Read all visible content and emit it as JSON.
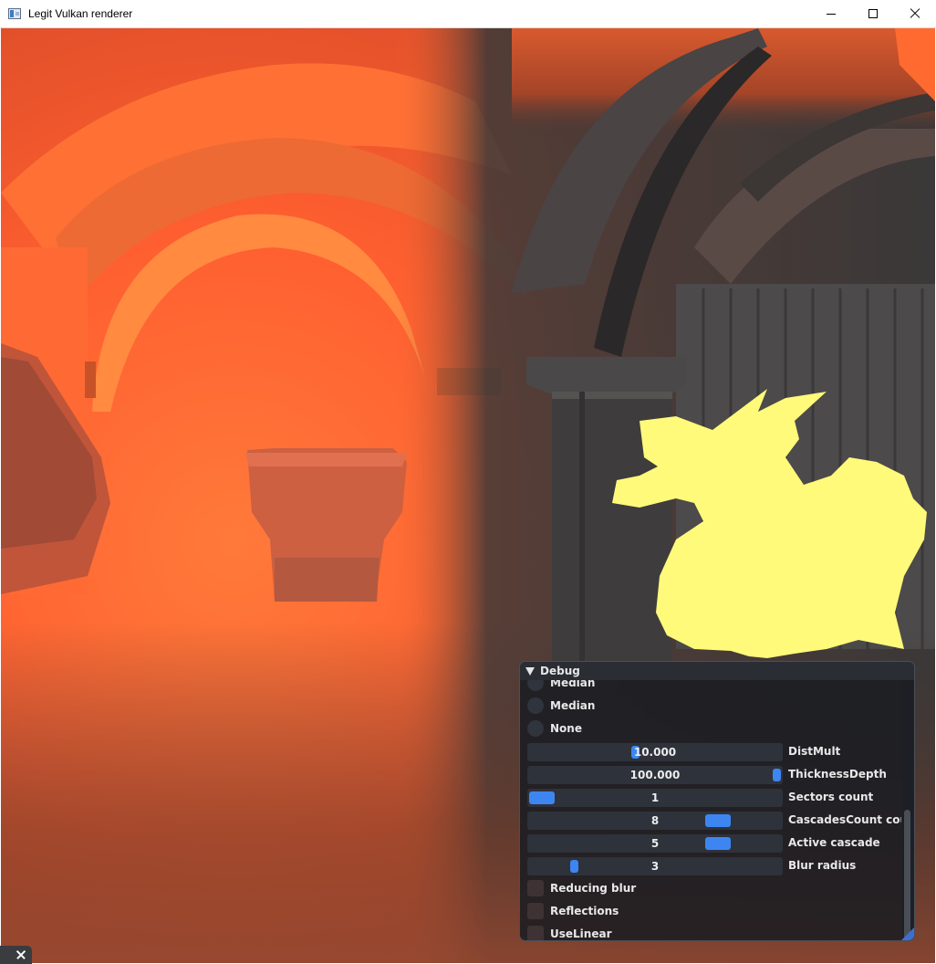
{
  "window": {
    "title": "Legit Vulkan renderer"
  },
  "debug_panel": {
    "title": "Debug",
    "radio_options": [
      {
        "label": "Median"
      },
      {
        "label": "Median"
      },
      {
        "label": "None"
      }
    ],
    "sliders": [
      {
        "name": "DistMult",
        "value": "10.000",
        "fraction": 0.42
      },
      {
        "name": "ThicknessDepth",
        "value": "100.000",
        "fraction": 1.0
      },
      {
        "name": "Sectors count",
        "value": "1",
        "fraction": 0.0
      },
      {
        "name": "CascadesCount coun",
        "value": "8",
        "fraction": 0.78
      },
      {
        "name": "Active cascade",
        "value": "5",
        "fraction": 0.78
      },
      {
        "name": "Blur radius",
        "value": "3",
        "fraction": 0.17
      }
    ],
    "checkboxes": [
      {
        "label": "Reducing blur",
        "checked": false
      },
      {
        "label": "Reflections",
        "checked": false
      },
      {
        "label": "UseLinear",
        "checked": false
      }
    ]
  },
  "colors": {
    "accent": "#3d86f2",
    "scene_orange": "#ff6a30",
    "dragon_yellow": "#fffa7a"
  },
  "icons": {
    "window_icon": "app-window-icon",
    "minimize": "minimize-icon",
    "maximize": "maximize-icon",
    "close": "close-icon",
    "collapse": "triangle-down-icon"
  }
}
